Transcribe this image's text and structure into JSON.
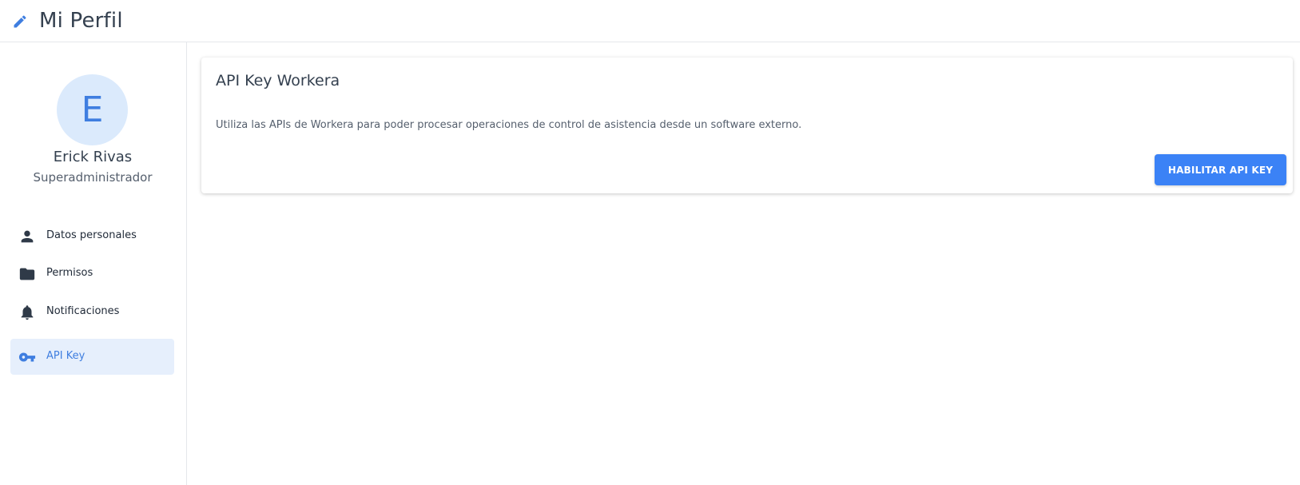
{
  "header": {
    "icon": "pencil-icon",
    "title": "Mi Perfil",
    "accent": "#3f7ee0"
  },
  "profile": {
    "avatar_initial": "E",
    "name": "Erick Rivas",
    "role": "Superadministrador"
  },
  "sidebar": {
    "items": [
      {
        "label": "Datos personales",
        "icon": "person-icon",
        "active": false
      },
      {
        "label": "Permisos",
        "icon": "folder-icon",
        "active": false
      },
      {
        "label": "Notificaciones",
        "icon": "bell-icon",
        "active": false
      },
      {
        "label": "API Key",
        "icon": "key-icon",
        "active": true
      }
    ]
  },
  "card": {
    "title": "API Key Workera",
    "description": "Utiliza las APIs de Workera para poder procesar operaciones de control de asistencia desde un software externo.",
    "button_label": "HABILITAR API KEY",
    "button_color": "#3b82f6"
  }
}
